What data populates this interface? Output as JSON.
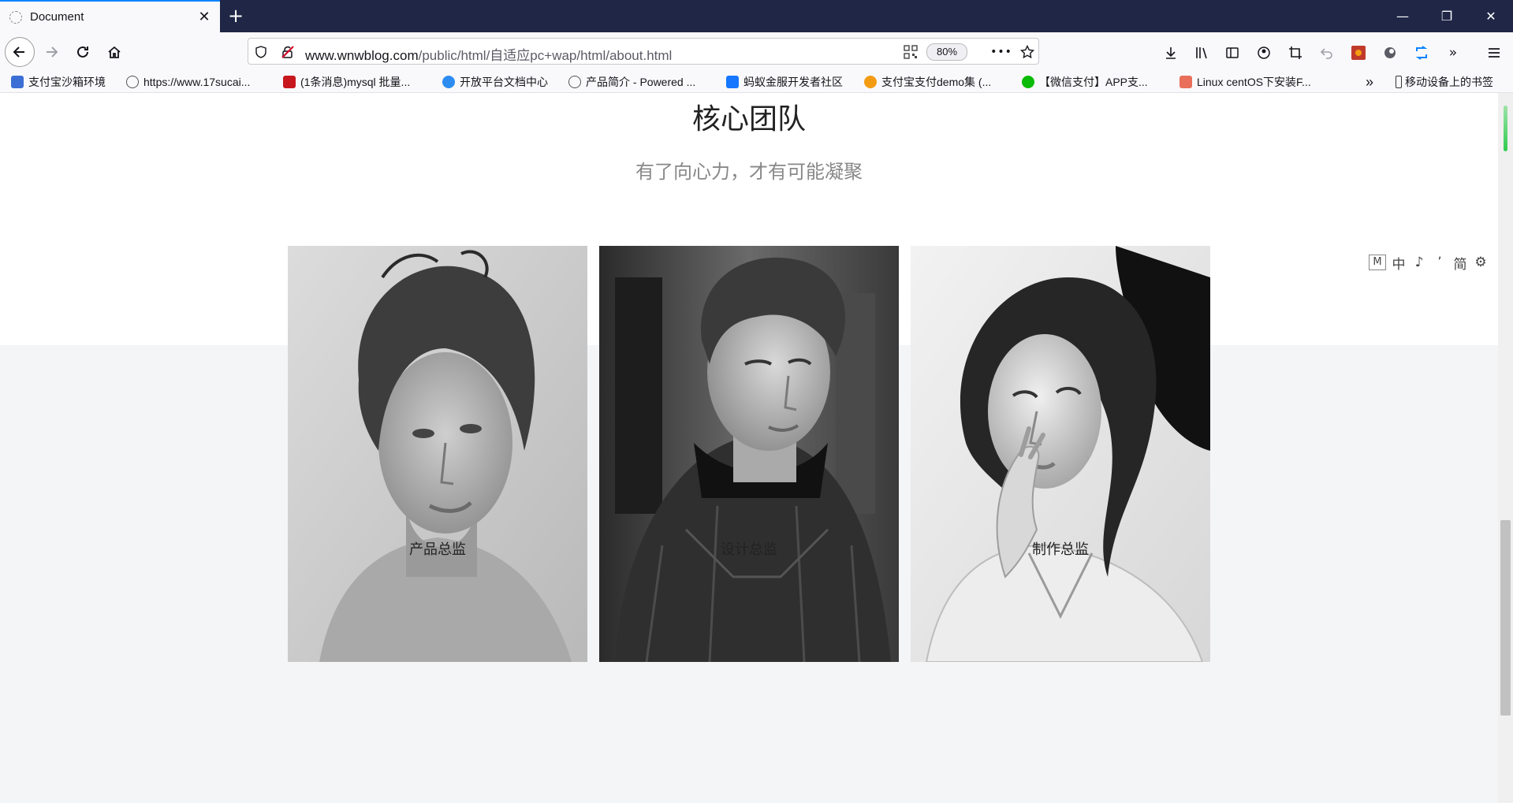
{
  "browser": {
    "tab_title": "Document",
    "tab_close_glyph": "✕",
    "new_tab_glyph": "+",
    "window_controls": {
      "minimize": "—",
      "restore": "❐",
      "close": "✕"
    },
    "url": {
      "host": "www.wnwblog.com",
      "path": "/public/html/自适应pc+wap/html/about.html"
    },
    "zoom": "80%",
    "more_glyph": "•••",
    "bookmarks": [
      {
        "label": "支付宝沙箱环境",
        "icon": "alipay-sandbox-icon",
        "color": "#3b6fd6"
      },
      {
        "label": "https://www.17sucai...",
        "icon": "globe-icon",
        "color": "#555555"
      },
      {
        "label": "(1条消息)mysql 批量...",
        "icon": "csdn-icon",
        "color": "#c8161d"
      },
      {
        "label": "开放平台文档中心",
        "icon": "doc-center-icon",
        "color": "#2d8cf0"
      },
      {
        "label": "产品简介 - Powered ...",
        "icon": "globe-icon",
        "color": "#555555"
      },
      {
        "label": "蚂蚁金服开发者社区",
        "icon": "antfin-icon",
        "color": "#1677ff"
      },
      {
        "label": "支付宝支付demo集 (...",
        "icon": "cat-icon",
        "color": "#f39c12"
      },
      {
        "label": "【微信支付】APP支...",
        "icon": "wechat-icon",
        "color": "#09bb07"
      },
      {
        "label": "Linux centOS下安装F...",
        "icon": "jianshu-icon",
        "color": "#ea6f5a"
      }
    ],
    "overflow_glyph": "»",
    "mobile_bookmarks": "移动设备上的书签"
  },
  "page": {
    "title": "核心团队",
    "subtitle": "有了向心力，才有可能凝聚",
    "team": [
      {
        "role": "产品总监",
        "photo": "portrait-woman-hair-up"
      },
      {
        "role": "设计总监",
        "photo": "portrait-man-jacket"
      },
      {
        "role": "制作总监",
        "photo": "portrait-woman-hand-at-lips"
      }
    ]
  },
  "translate_toolbar": {
    "items": [
      "M",
      "中",
      "♪",
      "ʼ",
      "简",
      "⚙",
      "⇡"
    ]
  },
  "colors": {
    "titlebar": "#1f2646",
    "accent": "#0a84ff",
    "toolbar_bg": "#f9f9fb",
    "page_gray": "#f4f5f7"
  }
}
